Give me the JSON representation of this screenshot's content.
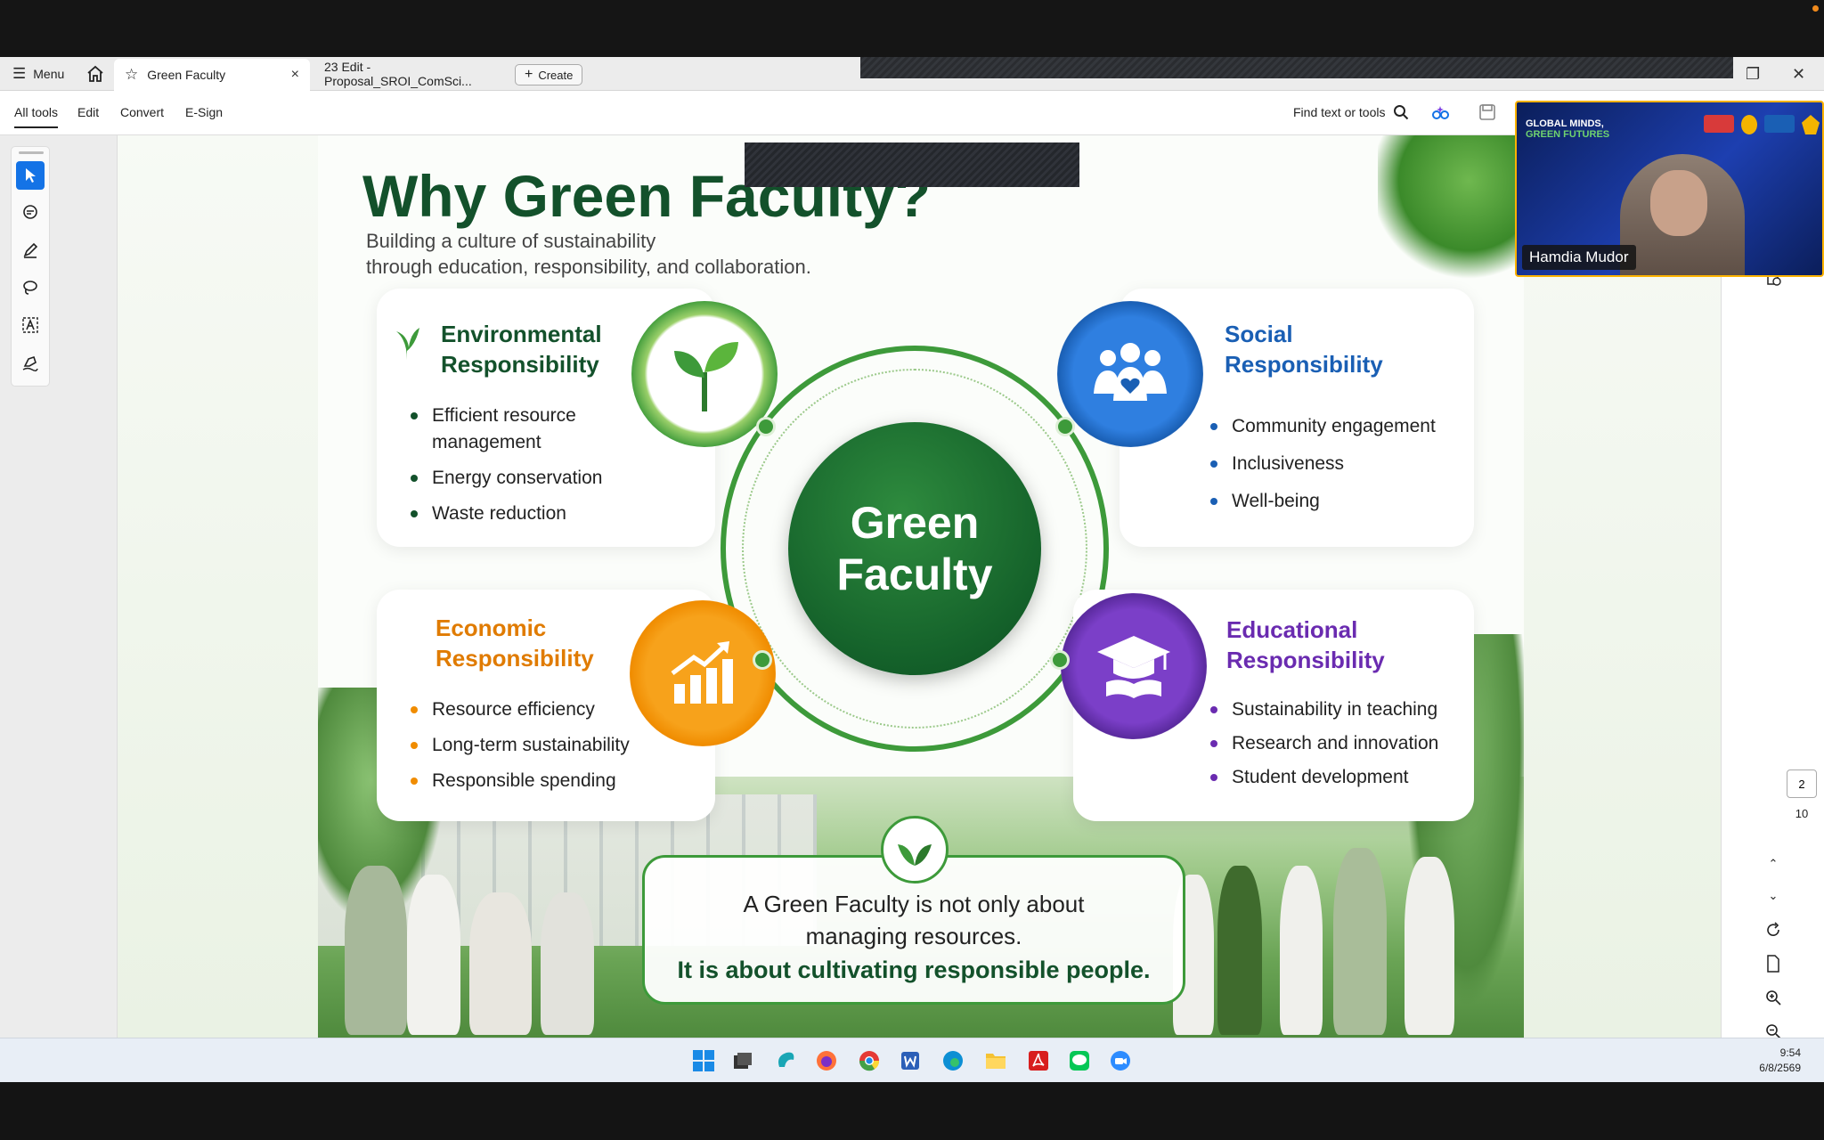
{
  "tabs": {
    "menu_label": "Menu",
    "active_tab": "Green Faculty",
    "tab2": "23 Edit -Proposal_SROI_ComSci...",
    "create_label": "Create",
    "close_glyph": "×"
  },
  "toolbar": {
    "all_tools": "All tools",
    "edit": "Edit",
    "convert": "Convert",
    "esign": "E-Sign",
    "find": "Find text or tools"
  },
  "slide": {
    "title": "Why Green Faculty?",
    "subtitle_1": "Building a culture of sustainability",
    "subtitle_2": "through education, responsibility, and collaboration.",
    "center_1": "Green",
    "center_2": "Faculty",
    "env": {
      "title_1": "Environmental",
      "title_2": "Responsibility",
      "items": [
        "Efficient resource",
        "management",
        "Energy conservation",
        "Waste reduction"
      ]
    },
    "social": {
      "title_1": "Social",
      "title_2": "Responsibility",
      "items": [
        "Community engagement",
        "Inclusiveness",
        "Well-being"
      ]
    },
    "econ": {
      "title_1": "Economic",
      "title_2": "Responsibility",
      "items": [
        "Resource efficiency",
        "Long-term sustainability",
        "Responsible spending"
      ]
    },
    "edu": {
      "title_1": "Educational",
      "title_2": "Responsibility",
      "items": [
        "Sustainability in teaching",
        "Research and innovation",
        "Student development"
      ]
    },
    "quote_1": "A Green Faculty is not only about",
    "quote_2": "managing resources.",
    "quote_3": "It is about cultivating responsible people."
  },
  "video": {
    "name": "Hamdia Mudor",
    "banner_1": "GLOBAL MINDS,",
    "banner_2": "GREEN FUTURES"
  },
  "page_nav": {
    "current": "2",
    "total": "10"
  },
  "clock": {
    "time": "9:54",
    "date": "6/8/2569"
  },
  "colors": {
    "green": "#13512b",
    "social_blue": "#1a5fb4",
    "econ_orange": "#f08c00",
    "edu_purple": "#6a2bb0",
    "accent_blue": "#1473e6"
  }
}
